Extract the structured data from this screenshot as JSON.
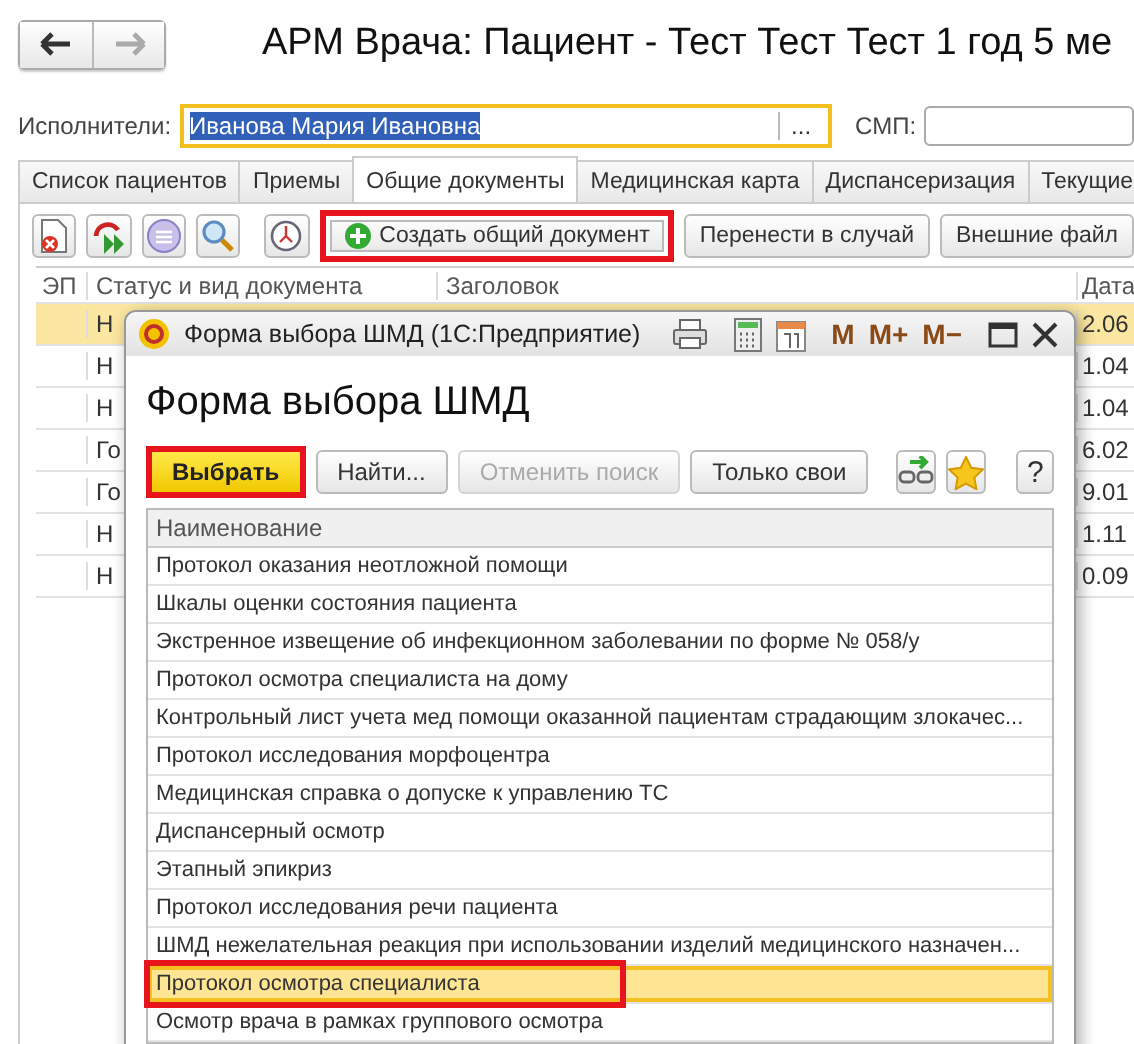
{
  "window": {
    "title": "АРМ Врача: Пациент - Тест Тест Тест 1 год 5 ме"
  },
  "performer": {
    "label": "Исполнители:",
    "value": "Иванова Мария Ивановна",
    "text_selected": true,
    "button": "..."
  },
  "smp": {
    "label": "СМП:"
  },
  "tabs": [
    {
      "label": "Список пациентов",
      "selected": false
    },
    {
      "label": "Приемы",
      "selected": false
    },
    {
      "label": "Общие документы",
      "selected": true
    },
    {
      "label": "Медицинская карта",
      "selected": false
    },
    {
      "label": "Диспансеризация",
      "selected": false
    },
    {
      "label": "Текущие",
      "selected": false
    }
  ],
  "toolbar": {
    "buttons": [
      {
        "label": "Создать общий документ",
        "kind": "create",
        "outlined": true
      },
      {
        "label": "Перенести в случай",
        "kind": "plain",
        "outlined": false
      },
      {
        "label": "Внешние файл",
        "kind": "plain",
        "outlined": false
      }
    ]
  },
  "table": {
    "columns": [
      "ЭП",
      "Статус и вид документа",
      "Заголовок",
      "Дата"
    ],
    "rows": [
      {
        "status": "Н",
        "date": "2.06",
        "selected": true
      },
      {
        "status": "Н",
        "date": "1.04",
        "selected": false
      },
      {
        "status": "Н",
        "date": "1.04",
        "selected": false
      },
      {
        "status": "Го",
        "date": "6.02",
        "selected": false
      },
      {
        "status": "Го",
        "date": "9.01",
        "selected": false
      },
      {
        "status": "Н",
        "date": "1.11",
        "selected": false
      },
      {
        "status": "Н",
        "date": "0.09",
        "selected": false
      }
    ]
  },
  "dialog": {
    "title": "Форма выбора ШМД  (1С:Предприятие)",
    "memory_buttons": [
      "M",
      "M+",
      "M−"
    ],
    "heading": "Форма выбора ШМД",
    "buttons": [
      {
        "label": "Выбрать",
        "kind": "default",
        "outlined": true
      },
      {
        "label": "Найти...",
        "kind": "normal",
        "outlined": false
      },
      {
        "label": "Отменить поиск",
        "kind": "disabled",
        "outlined": false
      },
      {
        "label": "Только свои",
        "kind": "normal",
        "outlined": false
      }
    ],
    "help": "?",
    "list": {
      "column": "Наименование",
      "rows": [
        {
          "name": "Протокол оказания неотложной помощи",
          "selected": false,
          "outlined": false
        },
        {
          "name": "Шкалы оценки состояния пациента",
          "selected": false,
          "outlined": false
        },
        {
          "name": "Экстренное извещение об инфекционном заболевании по форме № 058/у",
          "selected": false,
          "outlined": false
        },
        {
          "name": "Протокол осмотра специалиста на дому",
          "selected": false,
          "outlined": false
        },
        {
          "name": "Контрольный лист учета мед помощи оказанной пациентам страдающим злокачес...",
          "selected": false,
          "outlined": false
        },
        {
          "name": "Протокол исследования морфоцентра",
          "selected": false,
          "outlined": false
        },
        {
          "name": "Медицинская справка о допуске к управлению ТС",
          "selected": false,
          "outlined": false
        },
        {
          "name": "Диспансерный осмотр",
          "selected": false,
          "outlined": false
        },
        {
          "name": "Этапный эпикриз",
          "selected": false,
          "outlined": false
        },
        {
          "name": "Протокол исследования речи пациента",
          "selected": false,
          "outlined": false
        },
        {
          "name": "ШМД нежелательная реакция при использовании изделий медицинского назначен...",
          "selected": false,
          "outlined": false
        },
        {
          "name": "Протокол осмотра специалиста",
          "selected": true,
          "outlined": true
        },
        {
          "name": "Осмотр врача в рамках группового осмотра",
          "selected": false,
          "outlined": false
        }
      ]
    }
  }
}
